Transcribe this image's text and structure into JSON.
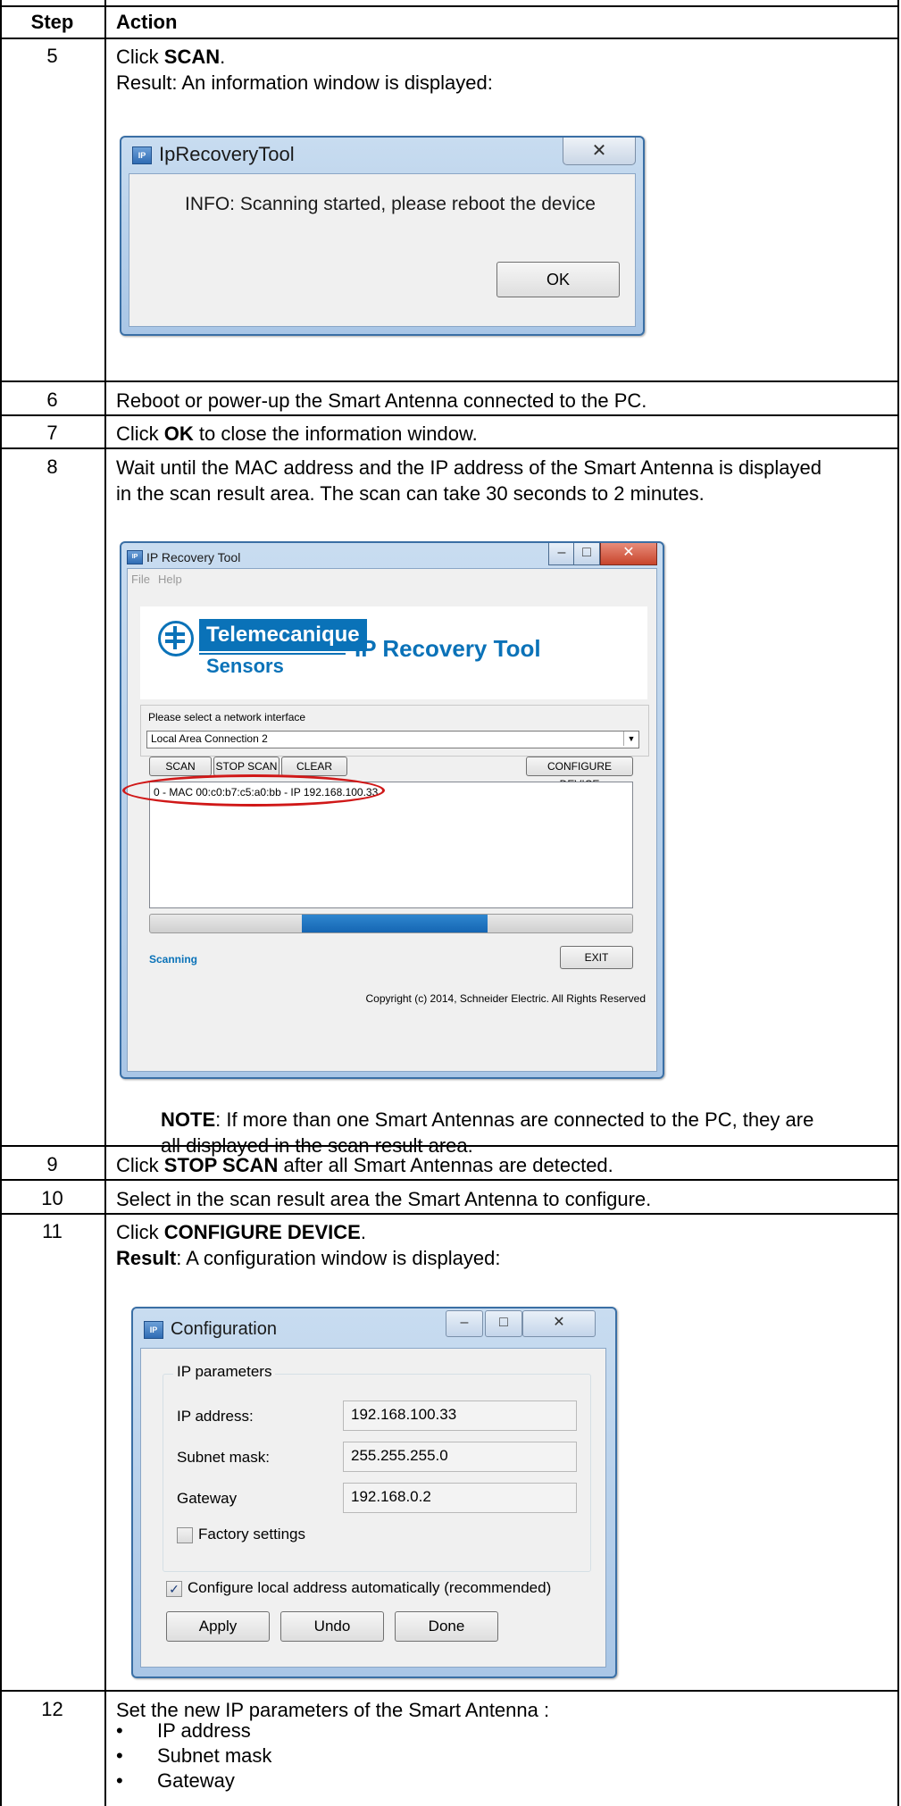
{
  "table": {
    "headers": {
      "step": "Step",
      "action": "Action"
    },
    "rows": [
      {
        "step": "5",
        "lines": [
          "Click SCAN.",
          "Result: An information window is displayed:"
        ],
        "bold": "SCAN",
        "line1_rest": "."
      },
      {
        "step": "6",
        "text": "Reboot or power-up the Smart Antenna connected to the PC."
      },
      {
        "step": "7",
        "bold": "OK",
        "rest": " to close the information window.",
        "prefix": "Click "
      },
      {
        "step": "8",
        "text1": "Wait until the MAC address and the IP address of the Smart Antenna is displayed",
        "text2": "in the scan result area. The scan can take 30 seconds to 2 minutes.",
        "note_bold": "NOTE",
        "note_rest1": ": If more than one Smart Antennas are connected to the PC, they are",
        "note_rest2": "all displayed in the scan result area."
      },
      {
        "step": "9",
        "prefix": "Click ",
        "bold": "STOP SCAN",
        "rest": " after all Smart Antennas are detected."
      },
      {
        "step": "10",
        "text": "Select in the scan result area the Smart Antenna to configure."
      },
      {
        "step": "11",
        "prefix": "Click ",
        "bold": "CONFIGURE DEVICE",
        "rest": ".",
        "result_bold": "Result",
        "result_rest": ": A configuration window is displayed:"
      },
      {
        "step": "12",
        "text": "Set the new IP parameters of the Smart Antenna :",
        "bullets": [
          "IP address",
          "Subnet mask",
          "Gateway"
        ]
      }
    ],
    "row5_click": "Click ",
    "row5_result": "Result: An information window is displayed:"
  },
  "info_window": {
    "title": "IpRecoveryTool",
    "message": "INFO: Scanning started, please reboot the device",
    "ok_label": "OK",
    "close_glyph": "✕"
  },
  "ip_tool_window": {
    "title": "IP Recovery Tool",
    "menu": [
      "File",
      "Help"
    ],
    "brand_name": "Telemecanique",
    "brand_sub": "Sensors",
    "app_title": "IP Recovery Tool",
    "interface_label": "Please select a network interface",
    "interface_value": "Local Area Connection 2",
    "buttons": {
      "scan": "SCAN",
      "stop_scan": "STOP SCAN",
      "clear": "CLEAR",
      "configure": "CONFIGURE DEVICE",
      "exit": "EXIT"
    },
    "scan_results": [
      "0 - MAC 00:c0:b7:c5:a0:bb - IP 192.168.100.33"
    ],
    "status": "Scanning",
    "copyright": "Copyright (c) 2014, Schneider Electric. All Rights Reserved",
    "progress_fraction": 0.5,
    "accent": "#0a72b8",
    "highlight": "#d01818"
  },
  "config_window": {
    "title": "Configuration",
    "group_label": "IP parameters",
    "fields": [
      {
        "label": "IP address:",
        "value": "192.168.100.33"
      },
      {
        "label": "Subnet mask:",
        "value": "255.255.255.0"
      },
      {
        "label": "Gateway",
        "value": "192.168.0.2"
      }
    ],
    "factory_label": "Factory settings",
    "factory_checked": false,
    "auto_label": "Configure local address automatically (recommended)",
    "auto_checked": true,
    "buttons": {
      "apply": "Apply",
      "undo": "Undo",
      "done": "Done"
    }
  }
}
